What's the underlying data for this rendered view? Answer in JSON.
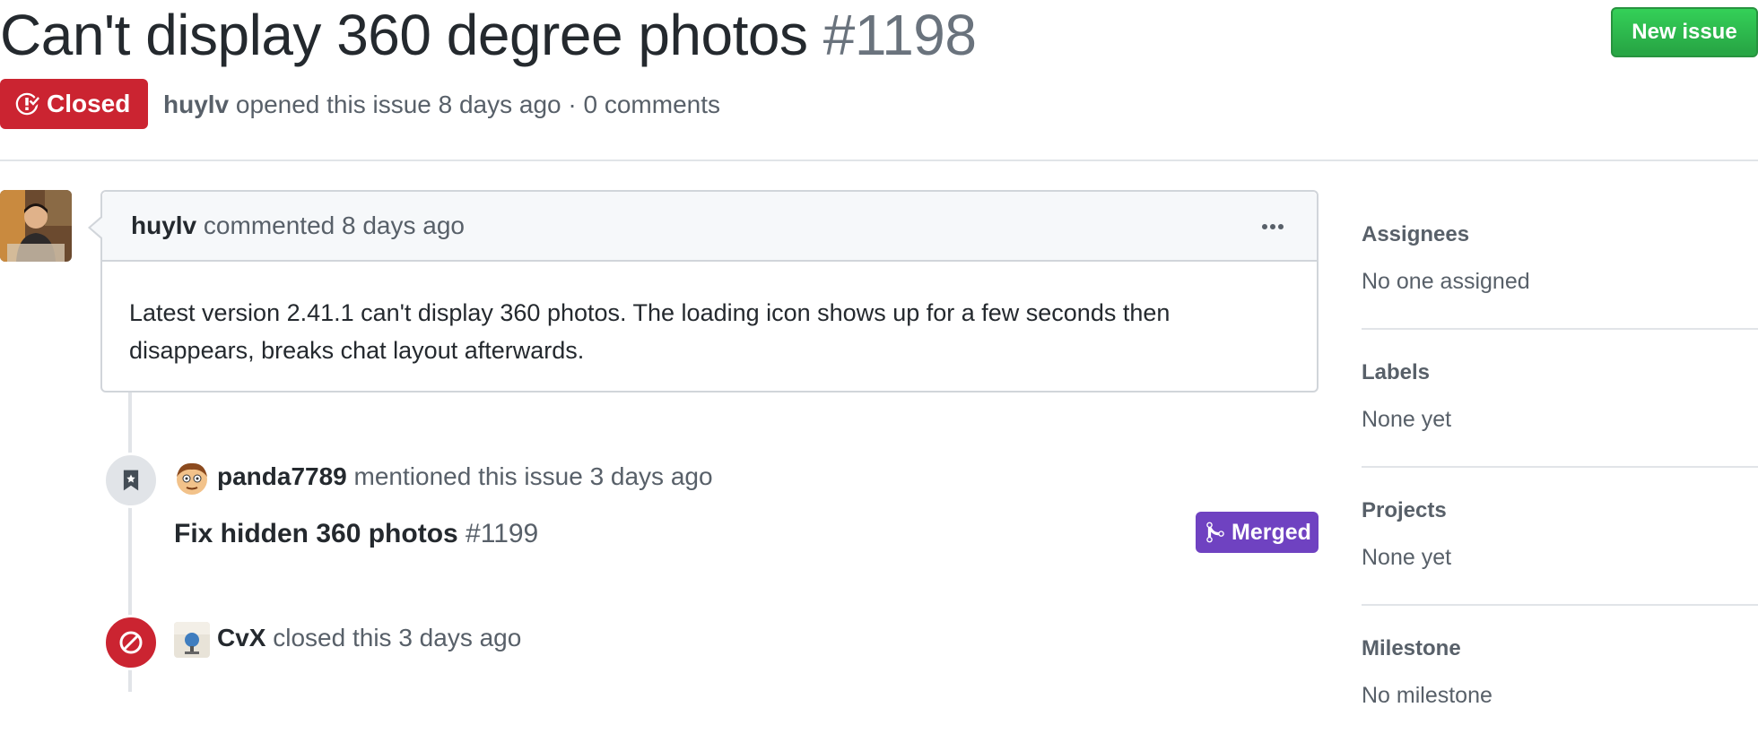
{
  "issue": {
    "title": "Can't display 360 degree photos",
    "number": "#1198",
    "state": "Closed",
    "author": "huylv",
    "opened_text": "opened this issue 8 days ago · 0 comments"
  },
  "header": {
    "new_issue_label": "New issue"
  },
  "comment": {
    "author": "huylv",
    "action": "commented 8 days ago",
    "body": "Latest version 2.41.1 can't display 360 photos. The loading icon shows up for a few seconds then disappears, breaks chat layout afterwards."
  },
  "events": {
    "mention": {
      "author": "panda7789",
      "text": "mentioned this issue 3 days ago",
      "ref_title": "Fix hidden 360 photos",
      "ref_number": "#1199",
      "ref_state": "Merged"
    },
    "closed": {
      "author": "CvX",
      "text": "closed this 3 days ago"
    }
  },
  "sidebar": {
    "assignees": {
      "heading": "Assignees",
      "value": "No one assigned"
    },
    "labels": {
      "heading": "Labels",
      "value": "None yet"
    },
    "projects": {
      "heading": "Projects",
      "value": "None yet"
    },
    "milestone": {
      "heading": "Milestone",
      "value": "No milestone"
    }
  },
  "colors": {
    "closed_red": "#cb2431",
    "merged_purple": "#6f42c1",
    "new_issue_green": "#28a745"
  }
}
